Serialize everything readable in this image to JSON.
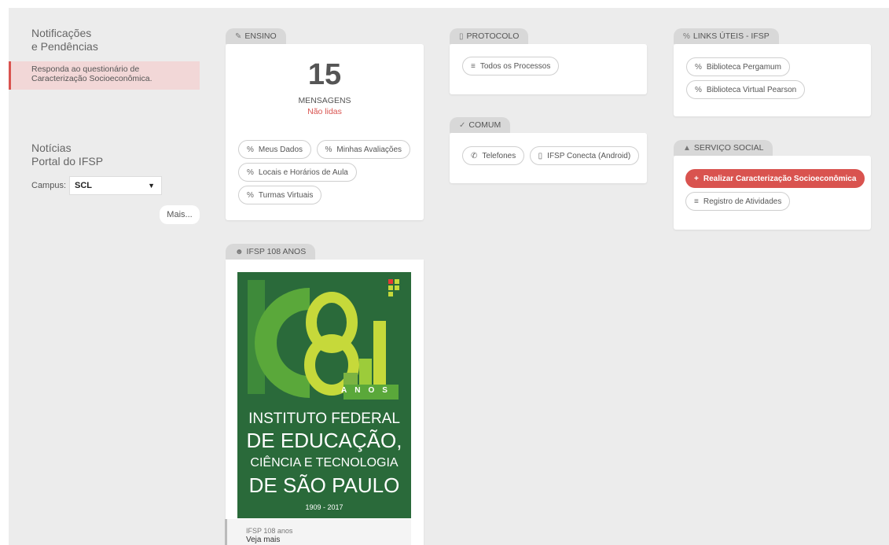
{
  "notifications": {
    "title_line1": "Notificações",
    "title_line2": "e Pendências",
    "alert_line1": "Responda ao questionário de",
    "alert_line2": "Caracterização Socioeconômica."
  },
  "news": {
    "title_line1": "Notícias",
    "title_line2": "Portal do IFSP",
    "campus_label": "Campus:",
    "campus_value": "SCL",
    "more_label": "Mais..."
  },
  "ensino": {
    "tab_label": "ENSINO",
    "count": "15",
    "messages_label": "MENSAGENS",
    "unread_label": "Não lidas",
    "links": [
      "Meus Dados",
      "Minhas Avaliações",
      "Locais e Horários de Aula",
      "Turmas Virtuais"
    ]
  },
  "protocolo": {
    "tab_label": "PROTOCOLO",
    "links": [
      "Todos os Processos"
    ]
  },
  "comum": {
    "tab_label": "COMUM",
    "links": [
      "Telefones",
      "IFSP Conecta (Android)"
    ]
  },
  "links_uteis": {
    "tab_label": "LINKS ÚTEIS - IFSP",
    "links": [
      "Biblioteca Pergamum",
      "Biblioteca Virtual Pearson"
    ]
  },
  "servico_social": {
    "tab_label": "SERVIÇO SOCIAL",
    "primary_action": "Realizar Caracterização Socioeconômica",
    "secondary_action": "Registro de Atividades"
  },
  "anniversary": {
    "tab_label": "IFSP 108 ANOS",
    "poster_number": "108",
    "poster_anos": [
      "A",
      "N",
      "O",
      "S"
    ],
    "poster_line1": "INSTITUTO FEDERAL",
    "poster_line2": "DE EDUCAÇÃO,",
    "poster_line3": "CIÊNCIA E TECNOLOGIA",
    "poster_line4": "DE SÃO PAULO",
    "poster_years": "1909 - 2017",
    "caption_title": "IFSP 108 anos",
    "caption_more": "Veja mais"
  },
  "colors": {
    "accent_red": "#d9534f",
    "poster_green": "#2a6a3a",
    "poster_lime": "#c6d93a"
  }
}
